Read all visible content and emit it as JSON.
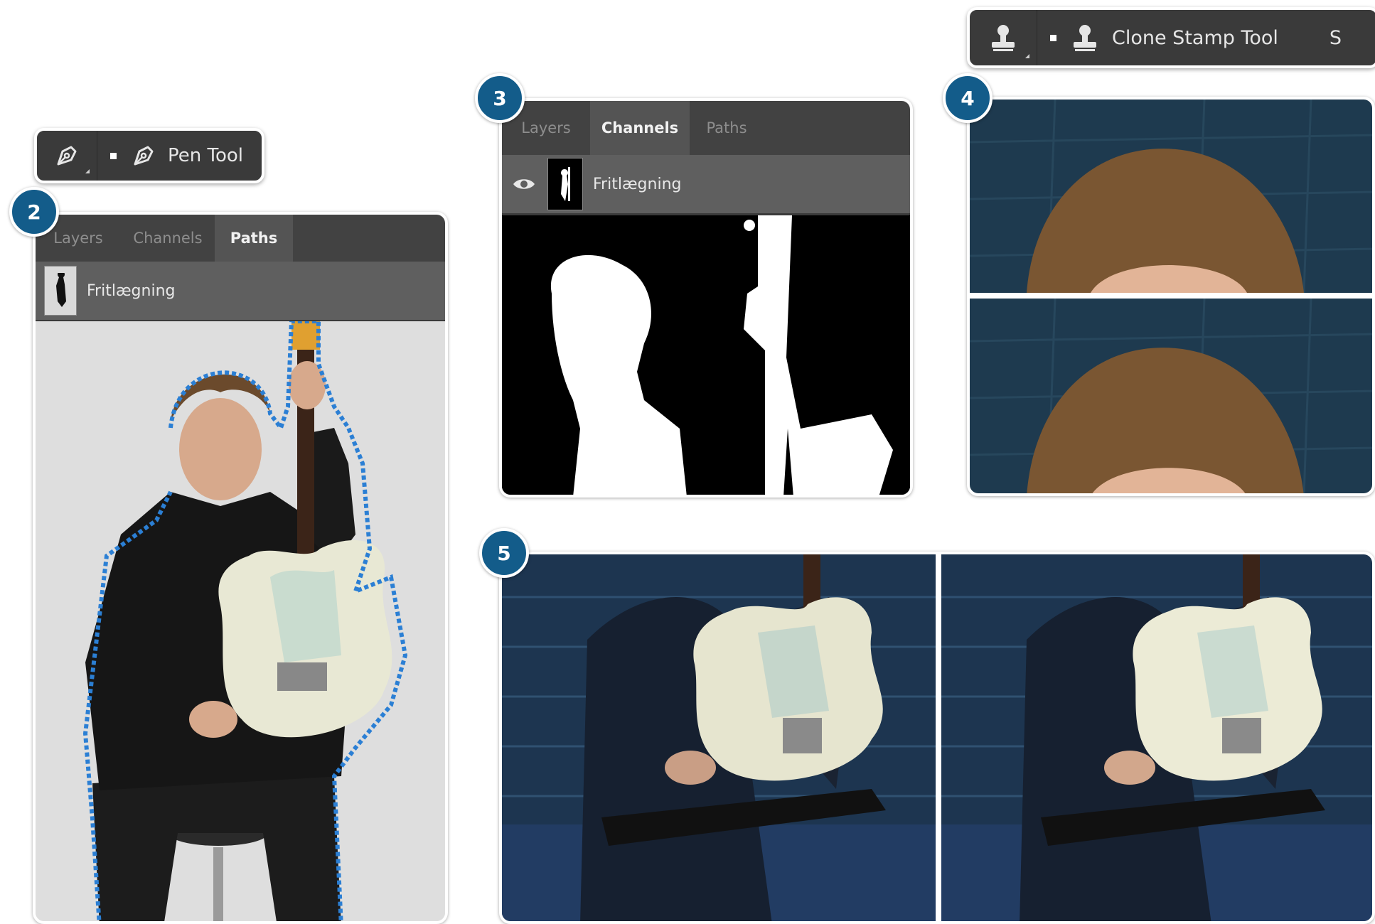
{
  "steps": {
    "s2": "2",
    "s3": "3",
    "s4": "4",
    "s5": "5"
  },
  "pen_tool": {
    "label": "Pen Tool",
    "icon": "pen-icon"
  },
  "clone_tool": {
    "label": "Clone Stamp Tool",
    "shortcut": "S",
    "icon": "clone-stamp-icon"
  },
  "panel2": {
    "tabs": [
      "Layers",
      "Channels",
      "Paths"
    ],
    "active_tab": "Paths",
    "item_label": "Fritlægning"
  },
  "panel3": {
    "tabs": [
      "Layers",
      "Channels",
      "Paths"
    ],
    "active_tab": "Channels",
    "item_label": "Fritlægning",
    "item_icon": "eye-icon"
  },
  "colors": {
    "badge": "#135c8a",
    "ps_dark": "#424242",
    "ps_row": "#5f5f5f",
    "path_outline": "#2b7fd4",
    "wall_blue": "#1e3a4f"
  }
}
